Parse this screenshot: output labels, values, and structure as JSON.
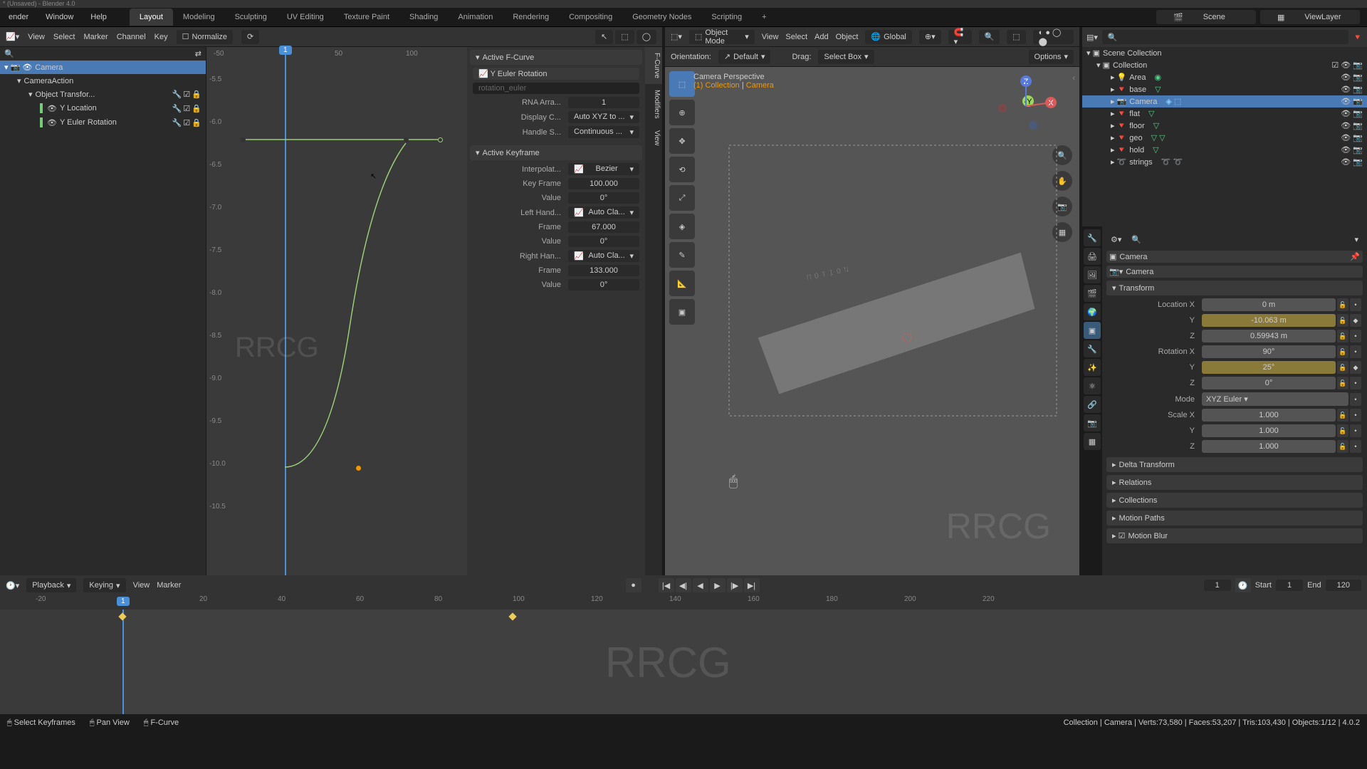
{
  "title": "* (Unsaved) - Blender 4.0",
  "topmenu": {
    "blender": "ender",
    "window": "Window",
    "help": "Help"
  },
  "tabs": [
    "Layout",
    "Modeling",
    "Sculpting",
    "UV Editing",
    "Texture Paint",
    "Shading",
    "Animation",
    "Rendering",
    "Compositing",
    "Geometry Nodes",
    "Scripting"
  ],
  "active_tab": 0,
  "scene_field": "Scene",
  "viewlayer_field": "ViewLayer",
  "graph": {
    "menus": [
      "View",
      "Select",
      "Marker",
      "Channel",
      "Key"
    ],
    "normalize": "Normalize",
    "ruler_top": [
      "-50",
      "50",
      "100"
    ],
    "playhead": "1",
    "yaxis": [
      "-5.5",
      "-6.0",
      "-6.5",
      "-7.0",
      "-7.5",
      "-8.0",
      "-8.5",
      "-9.0",
      "-9.5",
      "-10.0",
      "-10.5"
    ],
    "channels": {
      "camera": "Camera",
      "action": "CameraAction",
      "xform": "Object Transfor...",
      "yloc": "Y Location",
      "yrot": "Y Euler Rotation"
    }
  },
  "fcurve_panel": {
    "h1": "Active F-Curve",
    "name": "Y Euler Rotation",
    "path": "rotation_euler",
    "rna": "RNA Arra...",
    "rna_v": "1",
    "dispc": "Display C...",
    "dispc_v": "Auto XYZ to ...",
    "handles": "Handle S...",
    "handles_v": "Continuous ...",
    "h2": "Active Keyframe",
    "interp": "Interpolat...",
    "interp_v": "Bezier",
    "keyframe": "Key Frame",
    "keyframe_v": "100.000",
    "value": "Value",
    "value_v": "0°",
    "lh": "Left Hand...",
    "lh_v": "Auto Cla...",
    "lh_frame": "Frame",
    "lh_frame_v": "67.000",
    "lh_val": "Value",
    "lh_val_v": "0°",
    "rh": "Right Han...",
    "rh_v": "Auto Cla...",
    "rh_frame": "Frame",
    "rh_frame_v": "133.000",
    "rh_val": "Value",
    "rh_val_v": "0°"
  },
  "vtabs": {
    "fcurve": "F-Curve",
    "mod": "Modifiers",
    "view": "View"
  },
  "viewport": {
    "mode": "Object Mode",
    "menus": [
      "View",
      "Select",
      "Add",
      "Object"
    ],
    "orientation": "Orientation:",
    "orient_v": "Default",
    "drag": "Drag:",
    "drag_v": "Select Box",
    "options": "Options",
    "global": "Global",
    "persp": "Camera Perspective",
    "coll": "(1) Collection",
    "cam": "Camera"
  },
  "outliner": {
    "root": "Scene Collection",
    "coll": "Collection",
    "items": [
      "Area",
      "base",
      "Camera",
      "flat",
      "floor",
      "geo",
      "hold",
      "strings"
    ]
  },
  "props": {
    "obj": "Camera",
    "data": "Camera",
    "h_transform": "Transform",
    "loc_x": "Location X",
    "loc_x_v": "0 m",
    "loc_y": "Y",
    "loc_y_v": "-10.063 m",
    "loc_z": "Z",
    "loc_z_v": "0.59943 m",
    "rot_x": "Rotation X",
    "rot_x_v": "90°",
    "rot_y": "Y",
    "rot_y_v": "25°",
    "rot_z": "Z",
    "rot_z_v": "0°",
    "mode": "Mode",
    "mode_v": "XYZ Euler",
    "scl_x": "Scale X",
    "scl_x_v": "1.000",
    "scl_y": "Y",
    "scl_y_v": "1.000",
    "scl_z": "Z",
    "scl_z_v": "1.000",
    "h_delta": "Delta Transform",
    "h_rel": "Relations",
    "h_coll": "Collections",
    "h_mp": "Motion Paths",
    "h_mb": "Motion Blur"
  },
  "timeline": {
    "playback": "Playback",
    "keying": "Keying",
    "view": "View",
    "marker": "Marker",
    "cur": "1",
    "start": "Start",
    "start_v": "1",
    "end": "End",
    "end_v": "120",
    "ruler": [
      "-20",
      "1",
      "20",
      "40",
      "60",
      "80",
      "100",
      "120",
      "140",
      "160",
      "180",
      "200",
      "220"
    ]
  },
  "status": {
    "left1": "Select Keyframes",
    "left2": "Pan View",
    "left3": "F-Curve",
    "right": "Collection | Camera | Verts:73,580 | Faces:53,207 | Tris:103,430 | Objects:1/12 | 4.0.2"
  },
  "watermark": "RRCG"
}
